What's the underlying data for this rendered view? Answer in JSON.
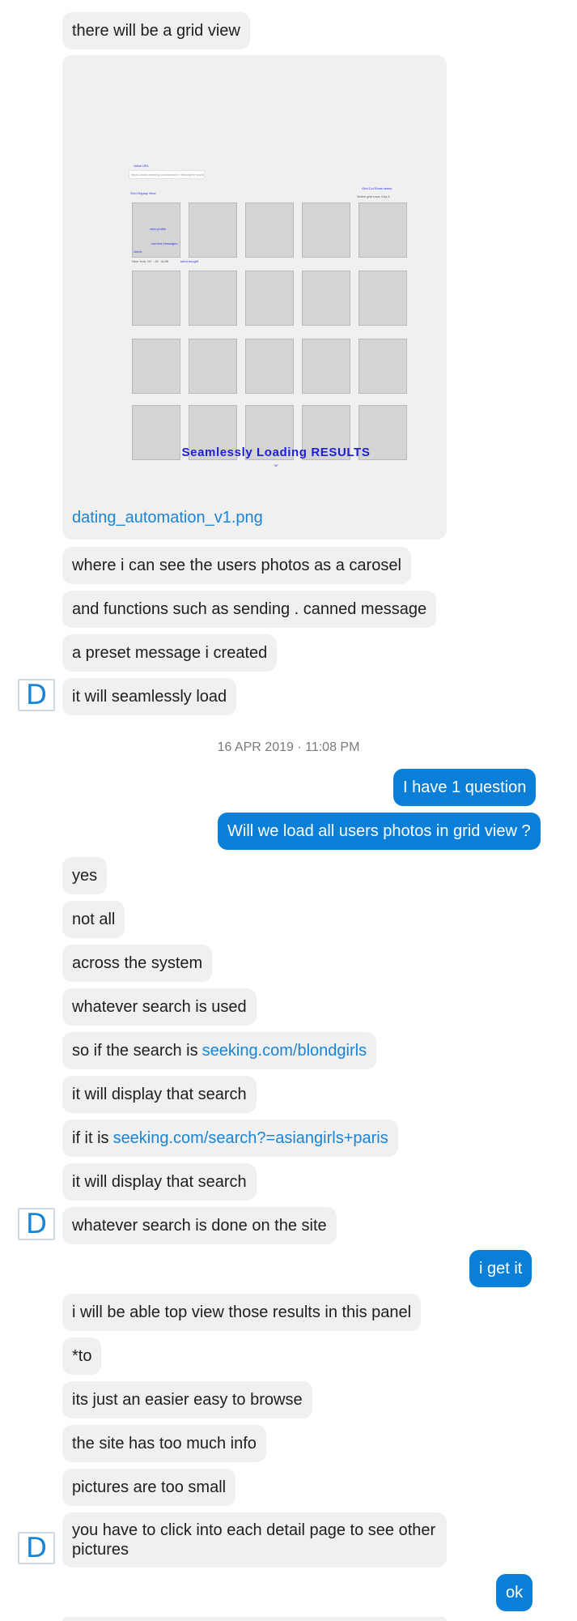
{
  "conversation": {
    "messages_top": [
      {
        "text": "there will be a grid view"
      }
    ],
    "attachment": {
      "filename": "dating_automation_v1.png",
      "mock": {
        "title": "Seamlessly Loading RESULTS",
        "chevron": "⌄",
        "small_texts": {
          "value_url": "Value URL",
          "url_input": "https://www.seeking.com/search?=blondgirls+paris",
          "grid_display": "Grid Display View",
          "grid_per_row": "Grid Col Rows select",
          "select_grid": "Select grid rows   4 by 5",
          "view_profile": "view profile",
          "check": "check",
          "canned": "canned messages",
          "new_york": "New York, NY · 26 · 5L6ft",
          "send_bought": "send bought"
        }
      }
    },
    "messages_after_attachment": [
      {
        "text": "where i can see the users photos as a carosel"
      },
      {
        "text": "and functions such as sending . canned message"
      },
      {
        "text": "a preset message i created"
      },
      {
        "text": "it will seamlessly load"
      }
    ],
    "timestamp": "16 APR 2019 · 11:08 PM",
    "outgoing_1": [
      {
        "text": "I have 1 question"
      },
      {
        "text": "Will we load all users photos in grid view ?"
      }
    ],
    "incoming_2": [
      {
        "text": "yes"
      },
      {
        "text": "not all"
      },
      {
        "text": "across the system"
      },
      {
        "text": "whatever search is used"
      },
      {
        "text": "so if the search is",
        "link": "seeking.com/blondgirls"
      },
      {
        "text": "it will display that search"
      },
      {
        "text": "if it is",
        "link": "seeking.com/search?=asiangirls+paris"
      },
      {
        "text": "it will display that search"
      },
      {
        "text": "whatever search is done on the site"
      }
    ],
    "outgoing_2": [
      {
        "text": "i get it"
      }
    ],
    "incoming_3": [
      {
        "text": "i will be able top view those results in this panel"
      },
      {
        "text": "*to"
      },
      {
        "text": "its just an easier easy to browse"
      },
      {
        "text": "the site has too much info"
      },
      {
        "text": "pictures are too small"
      },
      {
        "text": "you have to click into each detail page to see other pictures"
      }
    ],
    "outgoing_3": [
      {
        "text": "ok"
      }
    ],
    "avatar_letter": "D"
  },
  "colors": {
    "incoming_bubble": "#f0f0f0",
    "outgoing_bubble": "#0a7fd8",
    "link": "#1a84d6"
  }
}
